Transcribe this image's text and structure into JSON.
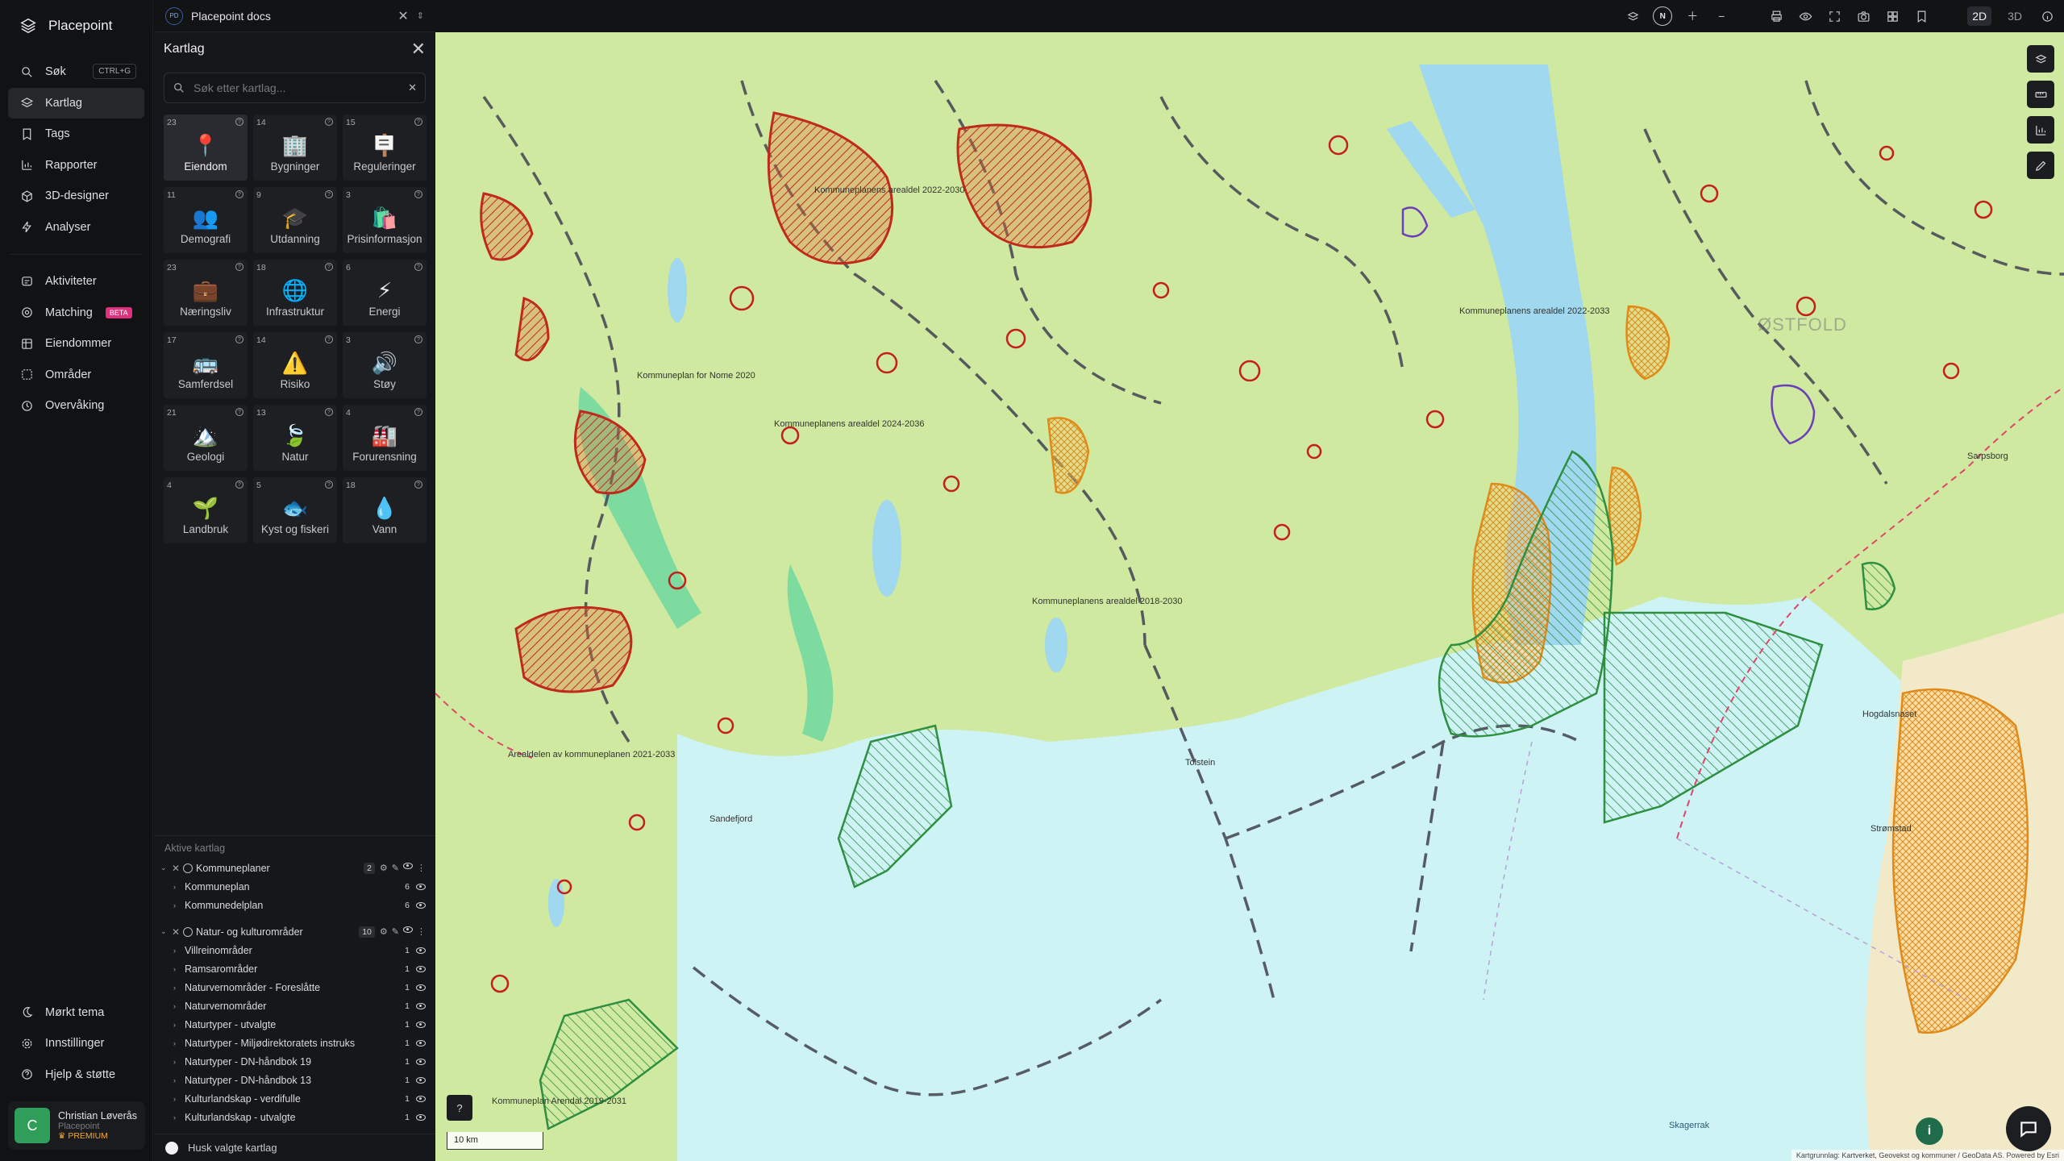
{
  "app": {
    "name": "Placepoint"
  },
  "nav": {
    "items": [
      {
        "label": "Søk",
        "shortcut": "CTRL+G",
        "icon": "search-icon"
      },
      {
        "label": "Kartlag",
        "icon": "layers-icon",
        "active": true
      },
      {
        "label": "Tags",
        "icon": "bookmark-icon"
      },
      {
        "label": "Rapporter",
        "icon": "bar-chart-icon"
      },
      {
        "label": "3D-designer",
        "icon": "cube-icon"
      },
      {
        "label": "Analyser",
        "icon": "lightning-icon"
      }
    ],
    "items2": [
      {
        "label": "Aktiviteter",
        "icon": "activity-icon"
      },
      {
        "label": "Matching",
        "badge": "BETA",
        "icon": "target-icon"
      },
      {
        "label": "Eiendommer",
        "icon": "grid-icon"
      },
      {
        "label": "Områder",
        "icon": "area-icon"
      },
      {
        "label": "Overvåking",
        "icon": "clock-icon"
      }
    ],
    "bottom": [
      {
        "label": "Mørkt tema",
        "icon": "moon-icon"
      },
      {
        "label": "Innstillinger",
        "icon": "gear-icon"
      },
      {
        "label": "Hjelp & støtte",
        "icon": "help-icon"
      }
    ],
    "user": {
      "initial": "C",
      "name": "Christian Løverås",
      "org": "Placepoint",
      "plan": "PREMIUM"
    }
  },
  "tab": {
    "badge": "PD",
    "title": "Placepoint docs"
  },
  "panel": {
    "title": "Kartlag",
    "search_placeholder": "Søk etter kartlag...",
    "categories": [
      {
        "count": "23",
        "label": "Eiendom",
        "icon": "📍",
        "active": true
      },
      {
        "count": "14",
        "label": "Bygninger",
        "icon": "🏢"
      },
      {
        "count": "15",
        "label": "Reguleringer",
        "icon": "🪧"
      },
      {
        "count": "11",
        "label": "Demografi",
        "icon": "👥"
      },
      {
        "count": "9",
        "label": "Utdanning",
        "icon": "🎓"
      },
      {
        "count": "3",
        "label": "Prisinformasjon",
        "icon": "🛍️"
      },
      {
        "count": "23",
        "label": "Næringsliv",
        "icon": "💼"
      },
      {
        "count": "18",
        "label": "Infrastruktur",
        "icon": "🌐"
      },
      {
        "count": "6",
        "label": "Energi",
        "icon": "⚡"
      },
      {
        "count": "17",
        "label": "Samferdsel",
        "icon": "🚌"
      },
      {
        "count": "14",
        "label": "Risiko",
        "icon": "⚠️"
      },
      {
        "count": "3",
        "label": "Støy",
        "icon": "🔊"
      },
      {
        "count": "21",
        "label": "Geologi",
        "icon": "🏔️"
      },
      {
        "count": "13",
        "label": "Natur",
        "icon": "🍃"
      },
      {
        "count": "4",
        "label": "Forurensning",
        "icon": "🏭"
      },
      {
        "count": "4",
        "label": "Landbruk",
        "icon": "🌱"
      },
      {
        "count": "5",
        "label": "Kyst og fiskeri",
        "icon": "🐟"
      },
      {
        "count": "18",
        "label": "Vann",
        "icon": "💧"
      }
    ],
    "active_title": "Aktive kartlag",
    "groups": [
      {
        "name": "Kommuneplaner",
        "count": "2",
        "children": [
          {
            "name": "Kommuneplan",
            "count": "6"
          },
          {
            "name": "Kommunedelplan",
            "count": "6"
          }
        ]
      },
      {
        "name": "Natur- og kulturområder",
        "count": "10",
        "children": [
          {
            "name": "Villreinområder",
            "count": "1"
          },
          {
            "name": "Ramsarområder",
            "count": "1"
          },
          {
            "name": "Naturvernområder - Foreslåtte",
            "count": "1"
          },
          {
            "name": "Naturvernområder",
            "count": "1"
          },
          {
            "name": "Naturtyper - utvalgte",
            "count": "1"
          },
          {
            "name": "Naturtyper - Miljødirektoratets instruks",
            "count": "1"
          },
          {
            "name": "Naturtyper - DN-håndbok 19",
            "count": "1"
          },
          {
            "name": "Naturtyper - DN-håndbok 13",
            "count": "1"
          },
          {
            "name": "Kulturlandskap - verdifulle",
            "count": "1"
          },
          {
            "name": "Kulturlandskap - utvalgte",
            "count": "1"
          }
        ]
      }
    ],
    "remember_label": "Husk valgte kartlag"
  },
  "topbar": {
    "compass": "N",
    "dim_2d": "2D",
    "dim_3d": "3D"
  },
  "map": {
    "scale": "10 km",
    "attribution": "Kartgrunnlag: Kartverket, Geovekst og kommuner / GeoData AS. Powered by Esri",
    "labels": [
      "Kommuneplanens arealdel 2022-2030",
      "Kommuneplan for Nome 2020",
      "Kommuneplanens arealdel 2024-2036",
      "Kommuneplanens arealdel 2018-2030",
      "Arealdelen av kommuneplanen 2021-2033",
      "Kommuneplan Arendal 2019-2031",
      "Kommuneplanens arealdel 2022-2033",
      "ØSTFOLD",
      "Tolstein",
      "Hogdalsnaset",
      "Strømstad",
      "Skagerrak",
      "Sandefjord",
      "Sarpsborg"
    ]
  }
}
